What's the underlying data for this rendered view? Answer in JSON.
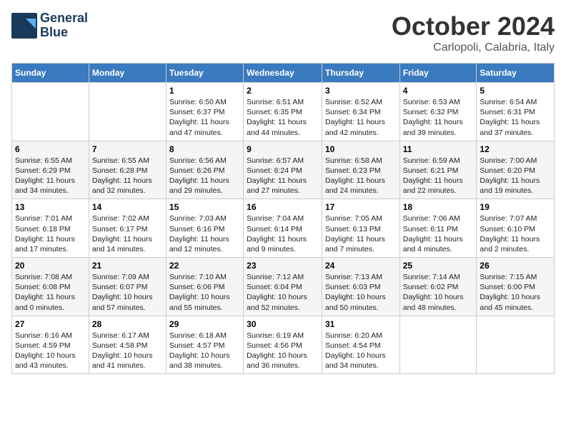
{
  "logo": {
    "line1": "General",
    "line2": "Blue"
  },
  "title": "October 2024",
  "location": "Carlopoli, Calabria, Italy",
  "weekdays": [
    "Sunday",
    "Monday",
    "Tuesday",
    "Wednesday",
    "Thursday",
    "Friday",
    "Saturday"
  ],
  "weeks": [
    [
      {
        "day": "",
        "info": ""
      },
      {
        "day": "",
        "info": ""
      },
      {
        "day": "1",
        "info": "Sunrise: 6:50 AM\nSunset: 6:37 PM\nDaylight: 11 hours and 47 minutes."
      },
      {
        "day": "2",
        "info": "Sunrise: 6:51 AM\nSunset: 6:35 PM\nDaylight: 11 hours and 44 minutes."
      },
      {
        "day": "3",
        "info": "Sunrise: 6:52 AM\nSunset: 6:34 PM\nDaylight: 11 hours and 42 minutes."
      },
      {
        "day": "4",
        "info": "Sunrise: 6:53 AM\nSunset: 6:32 PM\nDaylight: 11 hours and 39 minutes."
      },
      {
        "day": "5",
        "info": "Sunrise: 6:54 AM\nSunset: 6:31 PM\nDaylight: 11 hours and 37 minutes."
      }
    ],
    [
      {
        "day": "6",
        "info": "Sunrise: 6:55 AM\nSunset: 6:29 PM\nDaylight: 11 hours and 34 minutes."
      },
      {
        "day": "7",
        "info": "Sunrise: 6:55 AM\nSunset: 6:28 PM\nDaylight: 11 hours and 32 minutes."
      },
      {
        "day": "8",
        "info": "Sunrise: 6:56 AM\nSunset: 6:26 PM\nDaylight: 11 hours and 29 minutes."
      },
      {
        "day": "9",
        "info": "Sunrise: 6:57 AM\nSunset: 6:24 PM\nDaylight: 11 hours and 27 minutes."
      },
      {
        "day": "10",
        "info": "Sunrise: 6:58 AM\nSunset: 6:23 PM\nDaylight: 11 hours and 24 minutes."
      },
      {
        "day": "11",
        "info": "Sunrise: 6:59 AM\nSunset: 6:21 PM\nDaylight: 11 hours and 22 minutes."
      },
      {
        "day": "12",
        "info": "Sunrise: 7:00 AM\nSunset: 6:20 PM\nDaylight: 11 hours and 19 minutes."
      }
    ],
    [
      {
        "day": "13",
        "info": "Sunrise: 7:01 AM\nSunset: 6:18 PM\nDaylight: 11 hours and 17 minutes."
      },
      {
        "day": "14",
        "info": "Sunrise: 7:02 AM\nSunset: 6:17 PM\nDaylight: 11 hours and 14 minutes."
      },
      {
        "day": "15",
        "info": "Sunrise: 7:03 AM\nSunset: 6:16 PM\nDaylight: 11 hours and 12 minutes."
      },
      {
        "day": "16",
        "info": "Sunrise: 7:04 AM\nSunset: 6:14 PM\nDaylight: 11 hours and 9 minutes."
      },
      {
        "day": "17",
        "info": "Sunrise: 7:05 AM\nSunset: 6:13 PM\nDaylight: 11 hours and 7 minutes."
      },
      {
        "day": "18",
        "info": "Sunrise: 7:06 AM\nSunset: 6:11 PM\nDaylight: 11 hours and 4 minutes."
      },
      {
        "day": "19",
        "info": "Sunrise: 7:07 AM\nSunset: 6:10 PM\nDaylight: 11 hours and 2 minutes."
      }
    ],
    [
      {
        "day": "20",
        "info": "Sunrise: 7:08 AM\nSunset: 6:08 PM\nDaylight: 11 hours and 0 minutes."
      },
      {
        "day": "21",
        "info": "Sunrise: 7:09 AM\nSunset: 6:07 PM\nDaylight: 10 hours and 57 minutes."
      },
      {
        "day": "22",
        "info": "Sunrise: 7:10 AM\nSunset: 6:06 PM\nDaylight: 10 hours and 55 minutes."
      },
      {
        "day": "23",
        "info": "Sunrise: 7:12 AM\nSunset: 6:04 PM\nDaylight: 10 hours and 52 minutes."
      },
      {
        "day": "24",
        "info": "Sunrise: 7:13 AM\nSunset: 6:03 PM\nDaylight: 10 hours and 50 minutes."
      },
      {
        "day": "25",
        "info": "Sunrise: 7:14 AM\nSunset: 6:02 PM\nDaylight: 10 hours and 48 minutes."
      },
      {
        "day": "26",
        "info": "Sunrise: 7:15 AM\nSunset: 6:00 PM\nDaylight: 10 hours and 45 minutes."
      }
    ],
    [
      {
        "day": "27",
        "info": "Sunrise: 6:16 AM\nSunset: 4:59 PM\nDaylight: 10 hours and 43 minutes."
      },
      {
        "day": "28",
        "info": "Sunrise: 6:17 AM\nSunset: 4:58 PM\nDaylight: 10 hours and 41 minutes."
      },
      {
        "day": "29",
        "info": "Sunrise: 6:18 AM\nSunset: 4:57 PM\nDaylight: 10 hours and 38 minutes."
      },
      {
        "day": "30",
        "info": "Sunrise: 6:19 AM\nSunset: 4:56 PM\nDaylight: 10 hours and 36 minutes."
      },
      {
        "day": "31",
        "info": "Sunrise: 6:20 AM\nSunset: 4:54 PM\nDaylight: 10 hours and 34 minutes."
      },
      {
        "day": "",
        "info": ""
      },
      {
        "day": "",
        "info": ""
      }
    ]
  ]
}
